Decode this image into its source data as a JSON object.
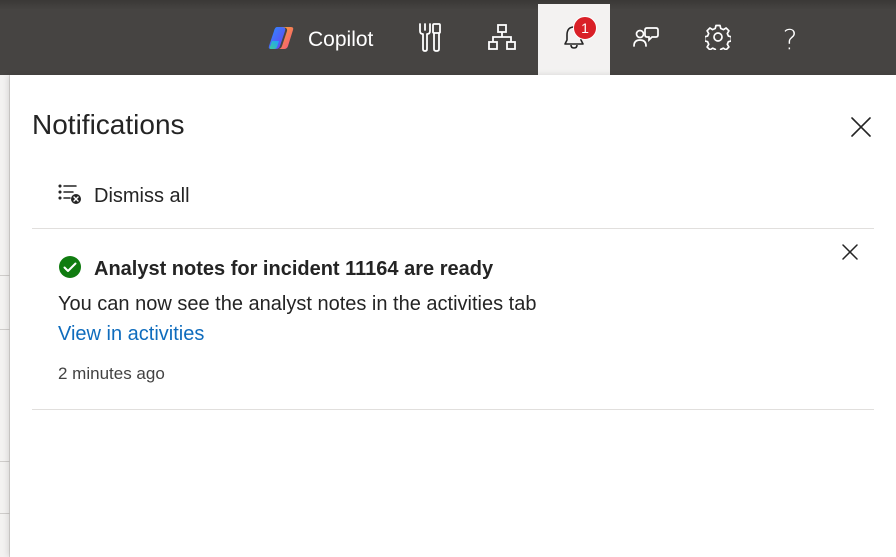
{
  "topbar": {
    "copilot_label": "Copilot",
    "icons": [
      "copilot-logo-icon",
      "tools-icon",
      "hierarchy-icon",
      "bell-icon",
      "community-icon",
      "gear-icon",
      "help-icon"
    ],
    "help_glyph": "?",
    "notification_count": "1",
    "background_color": "#464442",
    "active_color": "#f3f2f1",
    "badge_color": "#d92027"
  },
  "panel": {
    "title": "Notifications",
    "dismiss_all_label": "Dismiss all"
  },
  "notifications": [
    {
      "title": "Analyst notes for incident 11164 are ready",
      "body": "You can now see the analyst notes in the activities tab",
      "link": "View in activities",
      "time": "2 minutes ago",
      "status": "success",
      "status_color": "#107c10",
      "link_color": "#0f6cbd"
    }
  ]
}
